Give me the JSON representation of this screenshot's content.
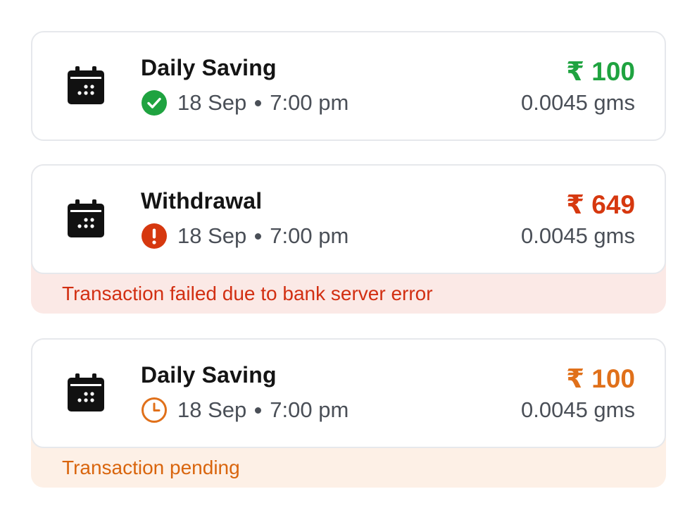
{
  "transactions": [
    {
      "title": "Daily Saving",
      "date": "18 Sep",
      "time": "7:00 pm",
      "amount": "₹ 100",
      "grams": "0.0045 gms",
      "status": "success",
      "status_icon": "check-circle-icon",
      "amount_color": "#1fa340",
      "message": ""
    },
    {
      "title": "Withdrawal",
      "date": "18 Sep",
      "time": "7:00 pm",
      "amount": "₹ 649",
      "grams": "0.0045 gms",
      "status": "failed",
      "status_icon": "alert-circle-icon",
      "amount_color": "#d6380f",
      "message": "Transaction failed due to bank server error"
    },
    {
      "title": "Daily Saving",
      "date": "18 Sep",
      "time": "7:00 pm",
      "amount": "₹ 100",
      "grams": "0.0045 gms",
      "status": "pending",
      "status_icon": "clock-icon",
      "amount_color": "#e0701a",
      "message": "Transaction pending"
    }
  ]
}
